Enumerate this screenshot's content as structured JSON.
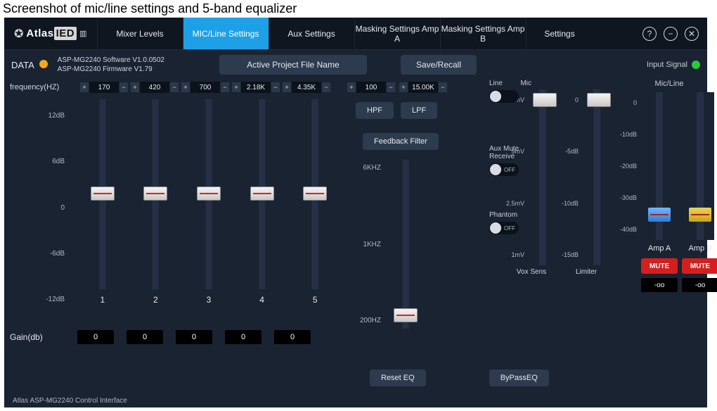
{
  "caption": "Screenshot of mic/line settings and 5-band equalizer",
  "tabs": [
    "Mixer Levels",
    "MIC/Line Settings",
    "Aux Settings",
    "Masking Settings Amp A",
    "Masking Settings Amp B",
    "Settings"
  ],
  "info": {
    "data_label": "DATA",
    "sw_line1": "ASP-MG2240 Software V1.0.0502",
    "sw_line2": "ASP-MG2240 Firmware V1.79",
    "project_btn": "Active Project File Name",
    "save_btn": "Save/Recall",
    "input_signal": "Input Signal"
  },
  "eq": {
    "freq_label": "frequency(HZ)",
    "freqs": [
      "170",
      "420",
      "700",
      "2.18K",
      "4.35K"
    ],
    "scale": [
      "12dB",
      "6dB",
      "0",
      "-6dB",
      "-12dB"
    ],
    "cols": [
      "1",
      "2",
      "3",
      "4",
      "5"
    ],
    "gain_label": "Gain(db)",
    "gains": [
      "0",
      "0",
      "0",
      "0",
      "0"
    ]
  },
  "center": {
    "hpf_val": "100",
    "lpf_val": "15.00K",
    "hpf_btn": "HPF",
    "lpf_btn": "LPF",
    "feedback_btn": "Feedback Filter",
    "fb_scale": [
      "6KHZ",
      "1KHZ",
      "200HZ"
    ]
  },
  "right": {
    "line_label": "Line",
    "mic_label": "Mic",
    "aux_mute_label": "Aux Mute Receive",
    "phantom_label": "Phantom",
    "off": "OFF",
    "vox_scale": [
      "10mV",
      "5mV",
      "2.5mV",
      "1mV"
    ],
    "vox_label": "Vox Sens",
    "lim_scale": [
      "0",
      "-5dB",
      "-10dB",
      "-15dB"
    ],
    "limiter_label": "Limiter",
    "micline_label": "Mic/Line",
    "amp_scale": [
      "0",
      "-10dB",
      "-20dB",
      "-30dB",
      "-40dB"
    ],
    "amp_a": "Amp A",
    "amp_b": "Amp B",
    "mute": "MUTE",
    "amp_a_val": "-oo",
    "amp_b_val": "-oo"
  },
  "bottom": {
    "reset": "Reset EQ",
    "bypass": "ByPassEQ"
  },
  "footer": "Atlas ASP-MG2240 Control Interface"
}
